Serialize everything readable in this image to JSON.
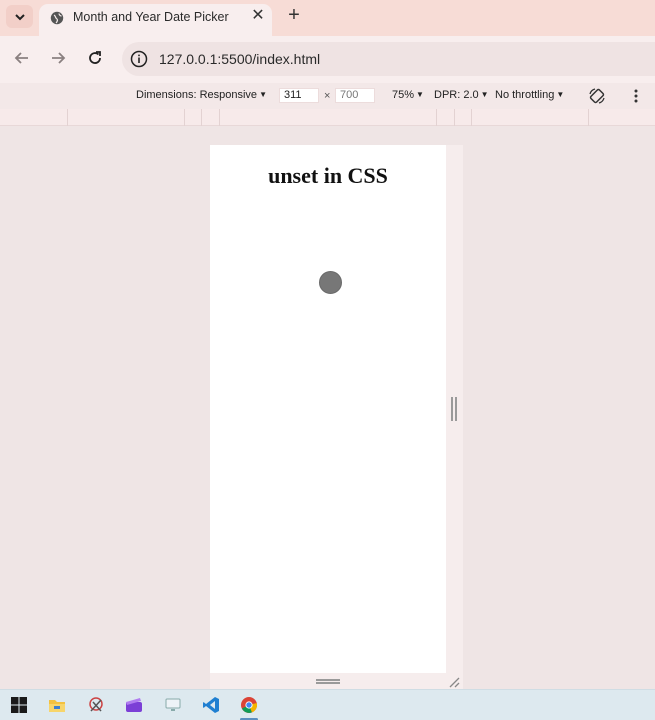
{
  "browser": {
    "tab": {
      "title": "Month and Year Date Picker"
    },
    "address": {
      "url": "127.0.0.1:5500/index.html"
    }
  },
  "devtools": {
    "dimensions_label": "Dimensions: Responsive",
    "width_value": "311",
    "times": "×",
    "height_value": "700",
    "zoom": "75%",
    "dpr": "DPR: 2.0",
    "throttling": "No throttling"
  },
  "page": {
    "heading": "unset in CSS"
  },
  "icons": {
    "tab_menu": "chevron-down-icon",
    "favicon": "globe-icon",
    "close": "close-icon",
    "new_tab": "plus-icon",
    "back": "arrow-left-icon",
    "forward": "arrow-right-icon",
    "reload": "reload-icon",
    "site_info": "info-icon",
    "rotate": "rotate-icon",
    "more": "kebab-menu-icon"
  },
  "taskbar": {
    "items": [
      "windows-start-icon",
      "file-explorer-icon",
      "snipping-tool-icon",
      "clipchamp-icon",
      "remote-desktop-icon",
      "vscode-icon",
      "chrome-icon"
    ]
  },
  "colors": {
    "tab_strip": "#f7dcd6",
    "toolbar": "#f8eeee",
    "viewport_bg": "#efe5e5",
    "taskbar": "#dde9ef"
  }
}
